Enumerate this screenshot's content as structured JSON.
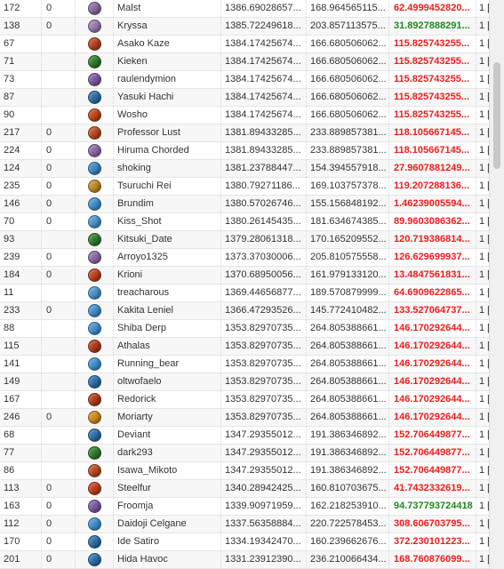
{
  "table": {
    "rows": [
      {
        "id": "172",
        "col2": "0",
        "avatar": "#8a6aa0",
        "name": "Malst",
        "a": "1386.69028657...",
        "b": "168.964565115...",
        "c": "62.4999452820...",
        "c_color": "red",
        "d": "1 ["
      },
      {
        "id": "138",
        "col2": "0",
        "avatar": "#9a7ab0",
        "name": "Kryssa",
        "a": "1385.72249618...",
        "b": "203.857113575...",
        "c": "31.8927888291...",
        "c_color": "green",
        "d": "1 ["
      },
      {
        "id": "67",
        "col2": "",
        "avatar": "#b8401c",
        "name": "Asako Kaze",
        "a": "1384.17425674...",
        "b": "166.680506062...",
        "c": "115.825743255...",
        "c_color": "red",
        "d": "1 ["
      },
      {
        "id": "71",
        "col2": "",
        "avatar": "#2f7a2a",
        "name": "Kieken",
        "a": "1384.17425674...",
        "b": "166.680506062...",
        "c": "115.825743255...",
        "c_color": "red",
        "d": "1 ["
      },
      {
        "id": "73",
        "col2": "",
        "avatar": "#7a58a0",
        "name": "raulendymion",
        "a": "1384.17425674...",
        "b": "166.680506062...",
        "c": "115.825743255...",
        "c_color": "red",
        "d": "1 ["
      },
      {
        "id": "87",
        "col2": "",
        "avatar": "#2a6ea8",
        "name": "Yasuki Hachi",
        "a": "1384.17425674...",
        "b": "166.680506062...",
        "c": "115.825743255...",
        "c_color": "red",
        "d": "1 ["
      },
      {
        "id": "90",
        "col2": "",
        "avatar": "#c0441a",
        "name": "Wosho",
        "a": "1384.17425674...",
        "b": "166.680506062...",
        "c": "115.825743255...",
        "c_color": "red",
        "d": "1 ["
      },
      {
        "id": "217",
        "col2": "0",
        "avatar": "#b84a20",
        "name": "Professor Lust",
        "a": "1381.89433285...",
        "b": "233.889857381...",
        "c": "118.105667145...",
        "c_color": "red",
        "d": "1 ["
      },
      {
        "id": "224",
        "col2": "0",
        "avatar": "#8c68a8",
        "name": "Hiruma Chorded",
        "a": "1381.89433285...",
        "b": "233.889857381...",
        "c": "118.105667145...",
        "c_color": "red",
        "d": "1 ["
      },
      {
        "id": "124",
        "col2": "0",
        "avatar": "#3a86c8",
        "name": "shoking",
        "a": "1381.23788447...",
        "b": "154.394557918...",
        "c": "27.9607881249...",
        "c_color": "red",
        "d": "1 ["
      },
      {
        "id": "235",
        "col2": "0",
        "avatar": "#c08a2a",
        "name": "Tsuruchi Rei",
        "a": "1380.79271186...",
        "b": "169.103757378...",
        "c": "119.207288136...",
        "c_color": "red",
        "d": "1 ["
      },
      {
        "id": "146",
        "col2": "0",
        "avatar": "#3f8fd0",
        "name": "Brundim",
        "a": "1380.57026746...",
        "b": "155.156848192...",
        "c": "1.46239005594...",
        "c_color": "red",
        "d": "1 ["
      },
      {
        "id": "70",
        "col2": "0",
        "avatar": "#4a94cc",
        "name": "Kiss_Shot",
        "a": "1380.26145435...",
        "b": "181.634674385...",
        "c": "89.9603086362...",
        "c_color": "red",
        "d": "1 ["
      },
      {
        "id": "93",
        "col2": "",
        "avatar": "#2f7a2a",
        "name": "Kitsuki_Date",
        "a": "1379.28061318...",
        "b": "170.165209552...",
        "c": "120.719386814...",
        "c_color": "red",
        "d": "1 ["
      },
      {
        "id": "239",
        "col2": "0",
        "avatar": "#8a6aa8",
        "name": "Arroyo1325",
        "a": "1373.37030006...",
        "b": "205.810575558...",
        "c": "126.629699937...",
        "c_color": "red",
        "d": "1 ["
      },
      {
        "id": "184",
        "col2": "0",
        "avatar": "#bf3d1c",
        "name": "Krioni",
        "a": "1370.68950056...",
        "b": "161.979133120...",
        "c": "13.4847561831...",
        "c_color": "red",
        "d": "1 ["
      },
      {
        "id": "11",
        "col2": "",
        "avatar": "#4a94cc",
        "name": "treacharous",
        "a": "1369.44656877...",
        "b": "189.570879999...",
        "c": "64.6909622865...",
        "c_color": "red",
        "d": "1 ["
      },
      {
        "id": "233",
        "col2": "0",
        "avatar": "#3f8fd0",
        "name": "Kakita Leniel",
        "a": "1366.47293526...",
        "b": "145.772410482...",
        "c": "133.527064737...",
        "c_color": "red",
        "d": "1 ["
      },
      {
        "id": "88",
        "col2": "",
        "avatar": "#3f8fd0",
        "name": "Shiba Derp",
        "a": "1353.82970735...",
        "b": "264.805388661...",
        "c": "146.170292644...",
        "c_color": "red",
        "d": "1 ["
      },
      {
        "id": "115",
        "col2": "",
        "avatar": "#b03a1a",
        "name": "Athalas",
        "a": "1353.82970735...",
        "b": "264.805388661...",
        "c": "146.170292644...",
        "c_color": "red",
        "d": "1 ["
      },
      {
        "id": "141",
        "col2": "",
        "avatar": "#3f8fd0",
        "name": "Running_bear",
        "a": "1353.82970735...",
        "b": "264.805388661...",
        "c": "146.170292644...",
        "c_color": "red",
        "d": "1 ["
      },
      {
        "id": "149",
        "col2": "",
        "avatar": "#2a6ea8",
        "name": "oltwofaelo",
        "a": "1353.82970735...",
        "b": "264.805388661...",
        "c": "146.170292644...",
        "c_color": "red",
        "d": "1 ["
      },
      {
        "id": "167",
        "col2": "",
        "avatar": "#b03a1a",
        "name": "Redorick",
        "a": "1353.82970735...",
        "b": "264.805388661...",
        "c": "146.170292644...",
        "c_color": "red",
        "d": "1 ["
      },
      {
        "id": "246",
        "col2": "0",
        "avatar": "#d08a1c",
        "name": "Moriarty",
        "a": "1353.82970735...",
        "b": "264.805388661...",
        "c": "146.170292644...",
        "c_color": "red",
        "d": "1 ["
      },
      {
        "id": "68",
        "col2": "",
        "avatar": "#2a6ea8",
        "name": "Deviant",
        "a": "1347.29355012...",
        "b": "191.386346892...",
        "c": "152.706449877...",
        "c_color": "red",
        "d": "1 ["
      },
      {
        "id": "77",
        "col2": "",
        "avatar": "#2f7a2a",
        "name": "dark293",
        "a": "1347.29355012...",
        "b": "191.386346892...",
        "c": "152.706449877...",
        "c_color": "red",
        "d": "1 ["
      },
      {
        "id": "86",
        "col2": "",
        "avatar": "#b84a20",
        "name": "Isawa_Mikoto",
        "a": "1347.29355012...",
        "b": "191.386346892...",
        "c": "152.706449877...",
        "c_color": "red",
        "d": "1 ["
      },
      {
        "id": "113",
        "col2": "0",
        "avatar": "#bf3d1c",
        "name": "Steelfur",
        "a": "1340.28942425...",
        "b": "160.810703675...",
        "c": "41.7432332619...",
        "c_color": "red",
        "d": "1 ["
      },
      {
        "id": "163",
        "col2": "0",
        "avatar": "#7a58a0",
        "name": "Froomja",
        "a": "1339.90971959...",
        "b": "162.218253910...",
        "c": "94.737793724418",
        "c_color": "green",
        "d": "1 ["
      },
      {
        "id": "112",
        "col2": "0",
        "avatar": "#3f8fd0",
        "name": "Daidoji Celgane",
        "a": "1337.56358884...",
        "b": "220.722578453...",
        "c": "308.606703795...",
        "c_color": "red",
        "d": "1 ["
      },
      {
        "id": "170",
        "col2": "0",
        "avatar": "#2a6ea8",
        "name": "Ide Satiro",
        "a": "1334.19342470...",
        "b": "160.239662676...",
        "c": "372.230101223...",
        "c_color": "red",
        "d": "1 ["
      },
      {
        "id": "201",
        "col2": "0",
        "avatar": "#2a6ea8",
        "name": "Hida Havoc",
        "a": "1331.23912390...",
        "b": "236.210066434...",
        "c": "168.760876099...",
        "c_color": "red",
        "d": "1 ["
      }
    ]
  }
}
